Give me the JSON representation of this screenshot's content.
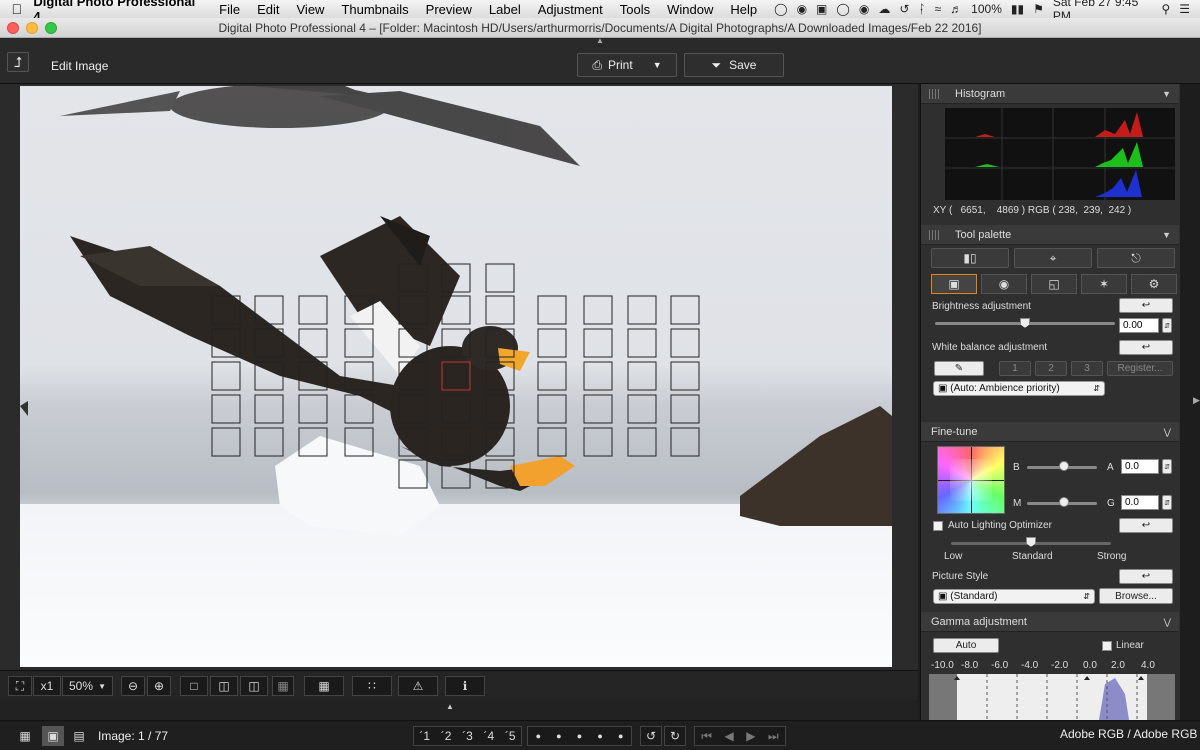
{
  "menubar": {
    "app": "Digital Photo Professional 4",
    "items": [
      "File",
      "Edit",
      "View",
      "Thumbnails",
      "Preview",
      "Label",
      "Adjustment",
      "Tools",
      "Window",
      "Help"
    ],
    "battery": "100%",
    "datetime": "Sat Feb 27  9:45 PM"
  },
  "window": {
    "title": "Digital Photo Professional 4 – [Folder: Macintosh HD/Users/arthurmorris/Documents/A Digital Photographs/A Downloaded Images/Feb 22 2016]"
  },
  "toolbar": {
    "mode_label": "Edit Image",
    "print_label": "Print",
    "save_label": "Save"
  },
  "histogram": {
    "title": "Histogram",
    "readout": "XY (   6651,    4869 ) RGB ( 238,  239,  242 )"
  },
  "tool_palette": {
    "title": "Tool palette",
    "brightness_label": "Brightness adjustment",
    "brightness_value": "0.00",
    "brightness_level": 0.5,
    "wb_label": "White balance adjustment",
    "wb_buttons": [
      "1",
      "2",
      "3"
    ],
    "register_label": "Register...",
    "wb_select": "(Auto: Ambience priority)"
  },
  "fine_tune": {
    "title": "Fine-tune",
    "b_label": "B",
    "a_label": "A",
    "a_value": "0.0",
    "m_label": "M",
    "g_label": "G",
    "g_value": "0.0",
    "alo_label": "Auto Lighting Optimizer",
    "alo_levels": [
      "Low",
      "Standard",
      "Strong"
    ],
    "picture_style_label": "Picture Style",
    "picture_style_value": "(Standard)",
    "browse_label": "Browse..."
  },
  "gamma": {
    "title": "Gamma adjustment",
    "auto_label": "Auto",
    "linear_label": "Linear",
    "scale": [
      "-10.0",
      "-8.0",
      "-6.0",
      "-4.0",
      "-2.0",
      "0.0",
      "2.0",
      "4.0"
    ]
  },
  "bottom": {
    "zoom_x1": "x1",
    "zoom_value": "50%",
    "image_counter": "Image: 1 / 77",
    "color_profile": "Adobe RGB / Adobe RGB",
    "rating_marks": [
      "´1",
      "´2",
      "´3",
      "´4",
      "´5"
    ]
  },
  "colors": {
    "accent_red": "#c0392b",
    "panel_bg": "#2f2f2f",
    "tab_active_border": "#e0861a"
  }
}
